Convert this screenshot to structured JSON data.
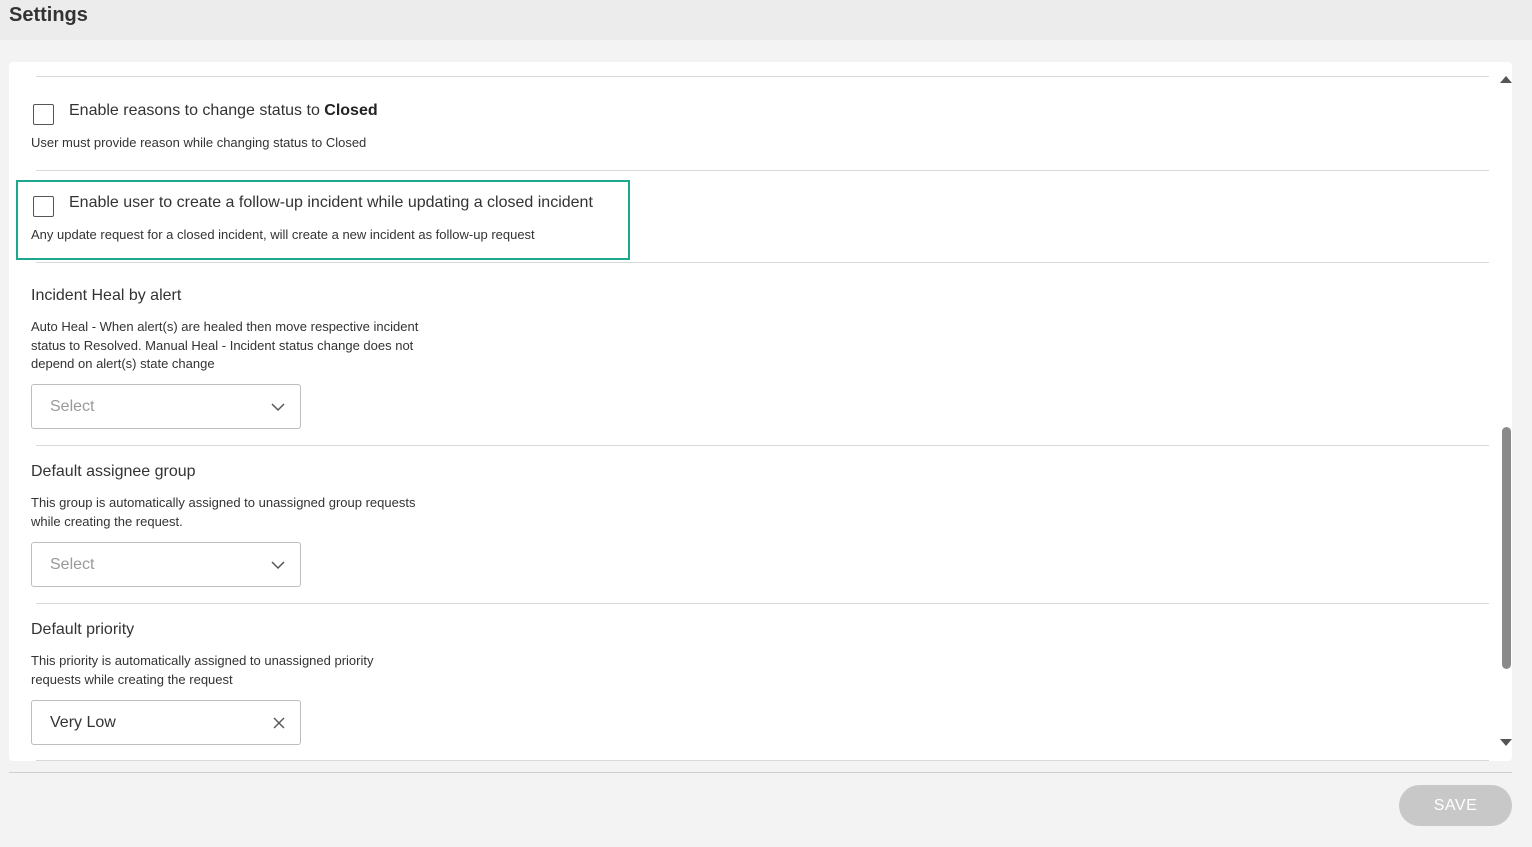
{
  "header": {
    "title": "Settings"
  },
  "settings": {
    "reasons_closed": {
      "label_prefix": "Enable reasons to change status to ",
      "label_bold": "Closed",
      "description": "User must provide reason while changing status to Closed",
      "checked": false
    },
    "follow_up": {
      "label": "Enable user to create a follow-up incident while updating a closed incident",
      "description": "Any update request for a closed incident, will create a new incident as follow-up request",
      "checked": false,
      "highlight_color": "#1ba88f"
    },
    "incident_heal": {
      "title": "Incident Heal by alert",
      "description_lines": [
        "Auto Heal - When alert(s) are healed then move respective incident",
        "status to Resolved. Manual Heal - Incident status change does not",
        "depend on alert(s) state change"
      ],
      "select_placeholder": "Select",
      "select_icon": "chevron-down-icon"
    },
    "default_assignee": {
      "title": "Default assignee group",
      "description_lines": [
        "This group is automatically assigned to unassigned group requests",
        "while creating the request."
      ],
      "select_placeholder": "Select",
      "select_icon": "chevron-down-icon"
    },
    "default_priority": {
      "title": "Default priority",
      "description_lines": [
        "This priority is automatically assigned to unassigned priority",
        "requests while creating the request"
      ],
      "selected_value": "Very Low",
      "clear_icon": "close-icon"
    }
  },
  "footer": {
    "save_label": "SAVE",
    "save_enabled": false
  },
  "colors": {
    "accent": "#1ba88f",
    "save_disabled_bg": "#c8c8c8",
    "header_bg": "#ececec"
  }
}
